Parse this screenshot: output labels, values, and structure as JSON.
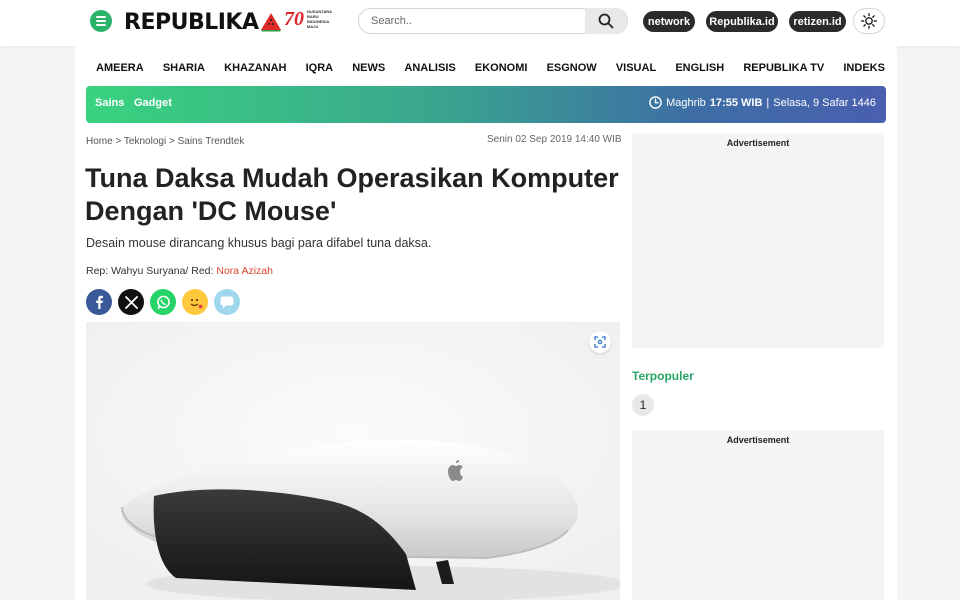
{
  "header": {
    "logo_text": "REPUBLIKA",
    "anniversary_number": "70",
    "anniversary_lines": [
      "NUSANTARA",
      "BARU",
      "INDONESIA",
      "MAJU"
    ],
    "search_placeholder": "Search..",
    "pills": [
      "network",
      "Republika.id",
      "retizen.id"
    ],
    "brand_green": "#2bb36b"
  },
  "nav": {
    "items": [
      "AMEERA",
      "SHARIA",
      "KHAZANAH",
      "IQRA",
      "NEWS",
      "ANALISIS",
      "EKONOMI",
      "ESGNOW",
      "VISUAL",
      "ENGLISH",
      "REPUBLIKA TV",
      "INDEKS"
    ]
  },
  "subbar": {
    "links": [
      "Sains",
      "Gadget"
    ],
    "prayer_label": "Maghrib",
    "prayer_time": "17:55 WIB",
    "separator": "|",
    "hijri_date": "Selasa, 9 Safar 1446"
  },
  "article": {
    "breadcrumb": [
      "Home",
      "Teknologi",
      "Sains Trendtek"
    ],
    "breadcrumb_sep": ">",
    "date": "Senin 02 Sep 2019 14:40 WIB",
    "title": "Tuna Daksa Mudah Operasikan Komputer Dengan 'DC Mouse'",
    "lead": "Desain mouse dirancang khusus bagi para difabel tuna daksa.",
    "byline_prefix": "Rep: Wahyu Suryana/ Red:",
    "editor": "Nora Azizah",
    "share_icons": [
      "facebook-icon",
      "x-icon",
      "whatsapp-icon",
      "emoji-reaction-icon",
      "comment-icon"
    ]
  },
  "sidebar": {
    "ad_label": "Advertisement",
    "popular_title": "Terpopuler",
    "first_rank": "1"
  }
}
